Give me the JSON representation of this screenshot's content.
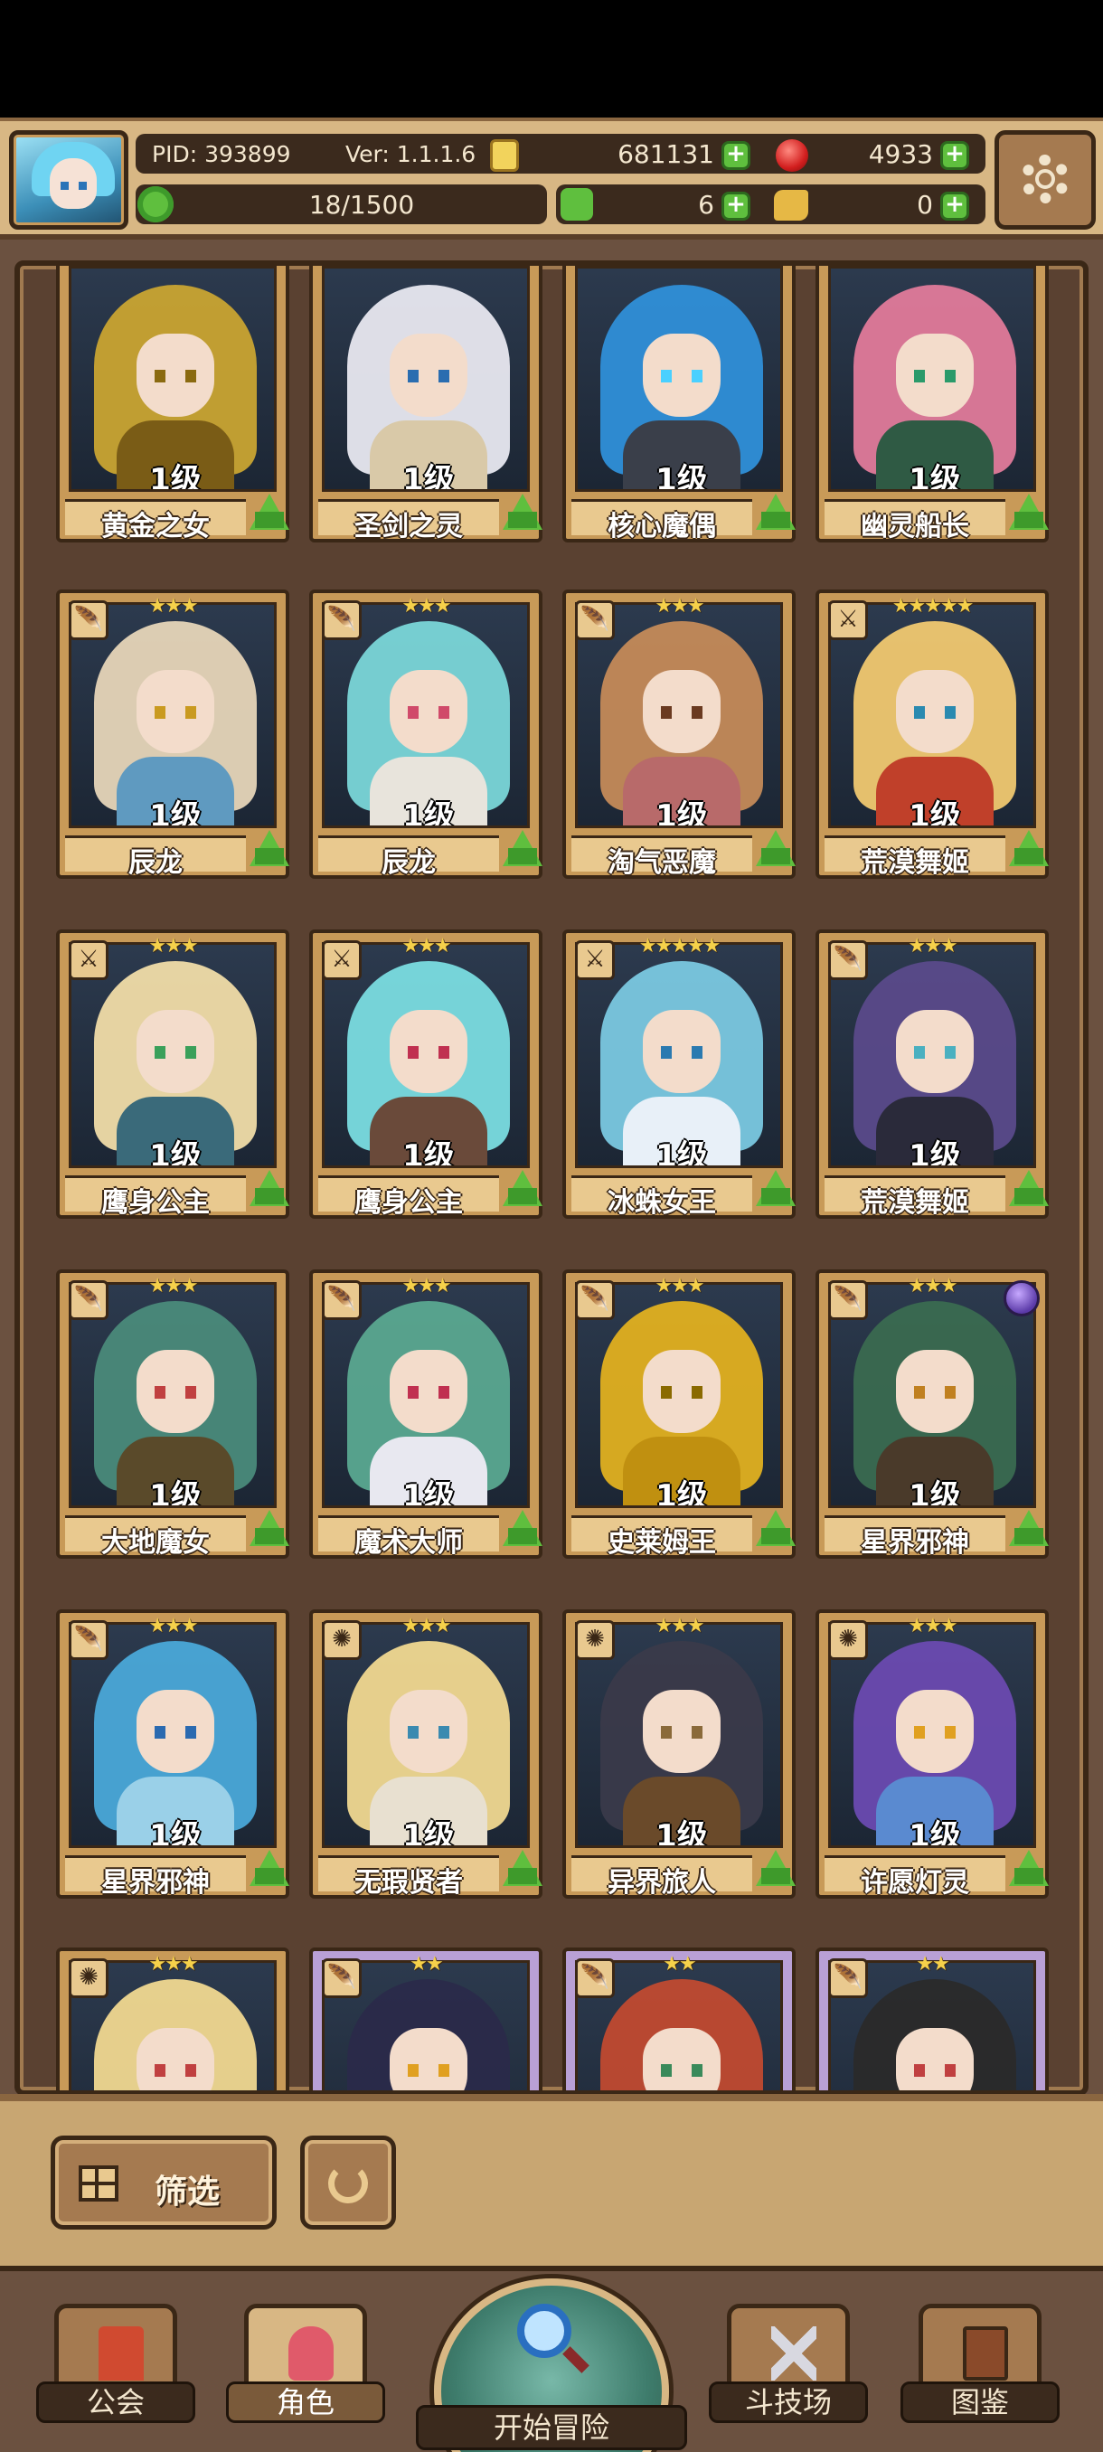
{
  "header": {
    "pid": "PID: 393899",
    "version": "Ver: 1.1.1.6",
    "gold": "681131",
    "gems": "4933",
    "stamina": "18/1500",
    "clover_count": "6",
    "item_count": "0"
  },
  "icons": {
    "avatar": "player-avatar",
    "gold": "gold-coin-icon",
    "gem": "red-gem-icon",
    "clover": "clover-icon",
    "settings": "gear-icon",
    "upgrade": "upgrade-arrow-icon"
  },
  "cards": [
    {
      "level": "1级",
      "name": "黄金之女",
      "hair": "#c9a431",
      "body": "#7a5c16",
      "eye": "#8a6a10",
      "stars": "",
      "cls": ""
    },
    {
      "level": "1级",
      "name": "圣剑之灵",
      "hair": "#e8e8f0",
      "body": "#d9c9a8",
      "eye": "#2a6db0",
      "stars": "",
      "cls": ""
    },
    {
      "level": "1级",
      "name": "核心魔偶",
      "hair": "#2f8fd8",
      "body": "#3a3f4a",
      "eye": "#4ad0ff",
      "stars": "",
      "cls": ""
    },
    {
      "level": "1级",
      "name": "幽灵船长",
      "hair": "#e07a9a",
      "body": "#2f5a44",
      "eye": "#2a9a6a",
      "stars": "",
      "cls": ""
    },
    {
      "level": "1级",
      "name": "辰龙",
      "hair": "#e6d5b8",
      "body": "#5f9ac0",
      "eye": "#c99a20",
      "stars": "★★★",
      "cls": "🪶"
    },
    {
      "level": "1级",
      "name": "辰龙",
      "hair": "#7ad6d8",
      "body": "#e8e4dc",
      "eye": "#d04a6a",
      "stars": "★★★",
      "cls": "🪶"
    },
    {
      "level": "1级",
      "name": "淘气恶魔",
      "hair": "#c48a58",
      "body": "#b86a6a",
      "eye": "#6a3a20",
      "stars": "★★★",
      "cls": "🪶"
    },
    {
      "level": "1级",
      "name": "荒漠舞姬",
      "hair": "#f0c870",
      "body": "#c0402a",
      "eye": "#2a8ab0",
      "stars": "★★★★★",
      "cls": "⚔"
    },
    {
      "level": "1级",
      "name": "鹰身公主",
      "hair": "#f0dca8",
      "body": "#3a6a7a",
      "eye": "#3aa05a",
      "stars": "★★★",
      "cls": "⚔"
    },
    {
      "level": "1级",
      "name": "鹰身公主",
      "hair": "#7adce0",
      "body": "#6a4a3a",
      "eye": "#c03050",
      "stars": "★★★",
      "cls": "⚔"
    },
    {
      "level": "1级",
      "name": "冰蛛女王",
      "hair": "#7ac8e0",
      "body": "#e8f0f8",
      "eye": "#2a7ab0",
      "stars": "★★★★★",
      "cls": "⚔"
    },
    {
      "level": "1级",
      "name": "荒漠舞姬",
      "hair": "#5a4a8a",
      "body": "#2a2a3a",
      "eye": "#4ab0c0",
      "stars": "★★★",
      "cls": "🪶"
    },
    {
      "level": "1级",
      "name": "大地魔女",
      "hair": "#4a8a7a",
      "body": "#5a4a2a",
      "eye": "#c04040",
      "stars": "★★★",
      "cls": "🪶"
    },
    {
      "level": "1级",
      "name": "魔术大师",
      "hair": "#5aa890",
      "body": "#e8e8f0",
      "eye": "#c03050",
      "stars": "★★★",
      "cls": "🪶"
    },
    {
      "level": "1级",
      "name": "史莱姆王",
      "hair": "#e0b020",
      "body": "#c09010",
      "eye": "#8a6a00",
      "stars": "★★★",
      "cls": "🪶"
    },
    {
      "level": "1级",
      "name": "星界邪神",
      "hair": "#3a6a50",
      "body": "#4a3a2a",
      "eye": "#c08020",
      "stars": "★★★",
      "cls": "🪶"
    },
    {
      "level": "1级",
      "name": "星界邪神",
      "hair": "#4aa8d8",
      "body": "#9ad0e8",
      "eye": "#2a6ab0",
      "stars": "★★★",
      "cls": "🪶"
    },
    {
      "level": "1级",
      "name": "无瑕贤者",
      "hair": "#f0d890",
      "body": "#e8e0d0",
      "eye": "#3a8ab0",
      "stars": "★★★",
      "cls": "✺"
    },
    {
      "level": "1级",
      "name": "异界旅人",
      "hair": "#3a3a4a",
      "body": "#6a4a2a",
      "eye": "#8a6a3a",
      "stars": "★★★",
      "cls": "✺"
    },
    {
      "level": "1级",
      "name": "许愿灯灵",
      "hair": "#6a4ab0",
      "body": "#5a8ad0",
      "eye": "#e0a020",
      "stars": "★★★",
      "cls": "✺"
    },
    {
      "level": "",
      "name": "",
      "hair": "#f0d890",
      "body": "#6ab0d0",
      "eye": "#c04040",
      "stars": "★★★",
      "cls": "✺"
    },
    {
      "level": "",
      "name": "",
      "hair": "#2a2a4a",
      "body": "#5aa040",
      "eye": "#e0a020",
      "stars": "★★",
      "cls": "🪶"
    },
    {
      "level": "",
      "name": "",
      "hair": "#c04a30",
      "body": "#5a3a2a",
      "eye": "#3a8a5a",
      "stars": "★★",
      "cls": "🪶"
    },
    {
      "level": "",
      "name": "",
      "hair": "#2a2a2a",
      "body": "#e8e0e0",
      "eye": "#c04040",
      "stars": "★★",
      "cls": "🪶"
    }
  ],
  "filter": {
    "label": "筛选"
  },
  "nav": {
    "guild": "公会",
    "character": "角色",
    "adventure": "开始冒险",
    "arena": "斗技场",
    "codex": "图鉴"
  }
}
